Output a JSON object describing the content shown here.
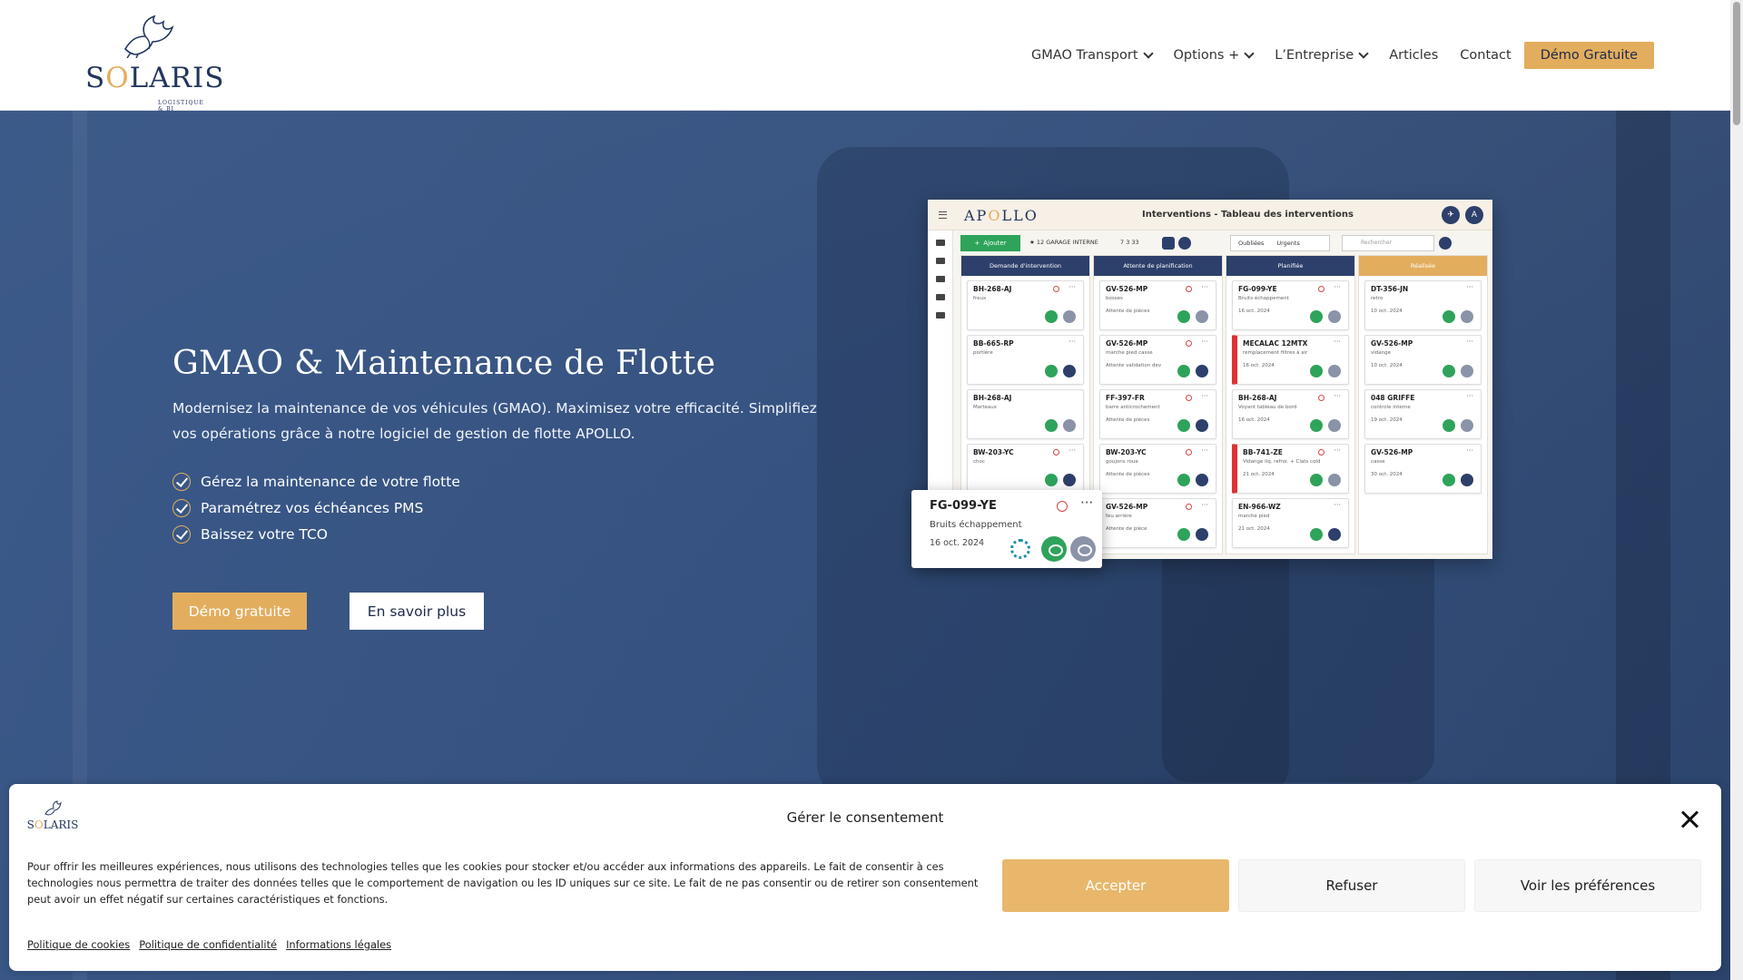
{
  "header": {
    "logo_text": "SOLARIS",
    "logo_sub": "LOGISTIQUE & BI",
    "nav": [
      {
        "label": "GMAO Transport",
        "has_dropdown": true
      },
      {
        "label": "Options +",
        "has_dropdown": true
      },
      {
        "label": "L’Entreprise",
        "has_dropdown": true
      },
      {
        "label": "Articles",
        "has_dropdown": false
      },
      {
        "label": "Contact",
        "has_dropdown": false
      }
    ],
    "cta": "Démo Gratuite"
  },
  "hero": {
    "title": "GMAO & Maintenance de Flotte",
    "lead": "Modernisez la maintenance de vos véhicules (GMAO). Maximisez votre efficacité. Simplifiez vos opérations grâce à notre logiciel de gestion de flotte APOLLO.",
    "checks": [
      "Gérez la maintenance de votre flotte",
      "Paramétrez vos échéances PMS",
      "Baissez votre TCO"
    ],
    "btn_demo": "Démo gratuite",
    "btn_more": "En savoir plus"
  },
  "app": {
    "logo": "APOLLO",
    "title": "Interventions - Tableau des interventions",
    "avatar": "A",
    "add": "Ajouter",
    "garage": "12 GARAGE INTERNE",
    "pagination": "7 3 33",
    "filter_oublies": "Oubliées",
    "filter_urgents": "Urgents",
    "search_placeholder": "Rechercher",
    "columns": [
      {
        "title": "Demande d'intervention",
        "cards": [
          {
            "id": "BH-268-AJ",
            "d1": "freux",
            "d2": ""
          },
          {
            "id": "BB-665-RP",
            "d1": "portière",
            "d2": ""
          },
          {
            "id": "BH-268-AJ",
            "d1": "Marteaux",
            "d2": ""
          },
          {
            "id": "BW-203-YC",
            "d1": "choc",
            "d2": ""
          }
        ]
      },
      {
        "title": "Attente de planification",
        "cards": [
          {
            "id": "GV-526-MP",
            "d1": "bosses",
            "d2": "Attente de pièces"
          },
          {
            "id": "GV-526-MP",
            "d1": "marche pied casse",
            "d2": "Attente validation dev"
          },
          {
            "id": "FF-397-FR",
            "d1": "barre anticrochement",
            "d2": "Attente de pièces"
          },
          {
            "id": "BW-203-YC",
            "d1": "goujons roue",
            "d2": "Attente de pièces"
          },
          {
            "id": "GV-526-MP",
            "d1": "feu arrière",
            "d2": "Attente de pièce"
          }
        ]
      },
      {
        "title": "Planifiée",
        "cards": [
          {
            "id": "FG-099-YE",
            "d1": "Bruits échappement",
            "d2": "16 oct. 2024",
            "red": false
          },
          {
            "id": "MECALAC 12MTX",
            "d1": "remplacement filtres à air",
            "d2": "16 oct. 2024",
            "red": true
          },
          {
            "id": "BH-268-AJ",
            "d1": "Voyant tableau de bord",
            "d2": "16 oct. 2024",
            "red": false
          },
          {
            "id": "BB-741-ZE",
            "d1": "Vidange liq. refroi. + Clats cold",
            "d2": "21 oct. 2024",
            "red": true
          },
          {
            "id": "EN-966-WZ",
            "d1": "marche pied",
            "d2": "21 oct. 2024",
            "red": false
          }
        ]
      },
      {
        "title": "Réalisée",
        "cards": [
          {
            "id": "DT-356-JN",
            "d1": "retro",
            "d2": "10 oct. 2024"
          },
          {
            "id": "GV-526-MP",
            "d1": "vidange",
            "d2": "10 oct. 2024"
          },
          {
            "id": "048 GRIFFE",
            "d1": "controle interne",
            "d2": "19 oct. 2024"
          },
          {
            "id": "GV-526-MP",
            "d1": "casse",
            "d2": "30 oct. 2024"
          }
        ]
      }
    ],
    "popup": {
      "id": "FG-099-YE",
      "desc": "Bruits échappement",
      "date": "16 oct. 2024"
    }
  },
  "consent": {
    "logo_text": "SOLARIS",
    "title": "Gérer le consentement",
    "text": "Pour offrir les meilleures expériences, nous utilisons des technologies telles que les cookies pour stocker et/ou accéder aux informations des appareils. Le fait de consentir à ces technologies nous permettra de traiter des données telles que le comportement de navigation ou les ID uniques sur ce site. Le fait de ne pas consentir ou de retirer son consentement peut avoir un effet négatif sur certaines caractéristiques et fonctions.",
    "accept": "Accepter",
    "refuse": "Refuser",
    "preferences": "Voir les préférences",
    "links": [
      "Politique de cookies",
      "Politique de confidentialité",
      "Informations légales"
    ]
  },
  "colors": {
    "gold": "#e3ad5e",
    "navy": "#22355d",
    "green": "#2ea35a"
  }
}
